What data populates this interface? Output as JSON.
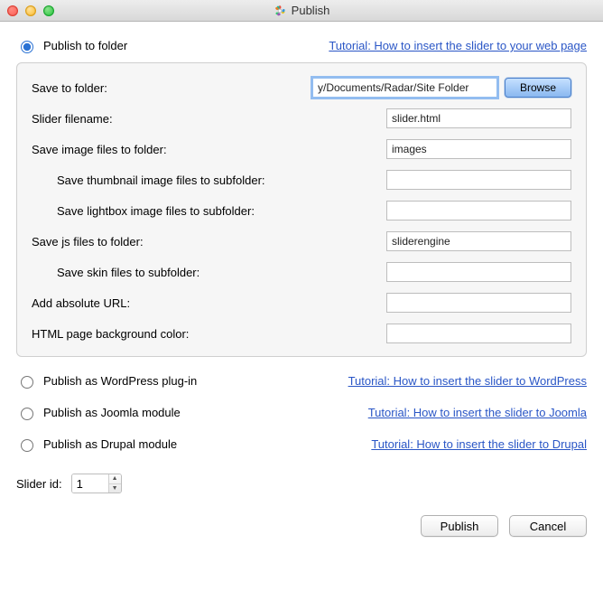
{
  "window": {
    "title": "Publish"
  },
  "options": {
    "folder": {
      "label": "Publish to folder",
      "selected": true,
      "tutorial": "Tutorial: How to insert the slider to your web page"
    },
    "wordpress": {
      "label": "Publish as WordPress plug-in",
      "selected": false,
      "tutorial": "Tutorial: How to insert the slider to WordPress"
    },
    "joomla": {
      "label": "Publish as Joomla module",
      "selected": false,
      "tutorial": "Tutorial: How to insert the slider to Joomla"
    },
    "drupal": {
      "label": "Publish as Drupal module",
      "selected": false,
      "tutorial": "Tutorial: How to insert the slider to Drupal"
    }
  },
  "form": {
    "save_folder": {
      "label": "Save to folder:",
      "value": "y/Documents/Radar/Site Folder",
      "browse": "Browse"
    },
    "slider_filename": {
      "label": "Slider filename:",
      "value": "slider.html"
    },
    "image_folder": {
      "label": "Save image files to folder:",
      "value": "images"
    },
    "thumb_subfolder": {
      "label": "Save thumbnail image files to subfolder:",
      "value": ""
    },
    "lightbox_subfolder": {
      "label": "Save lightbox image files to subfolder:",
      "value": ""
    },
    "js_folder": {
      "label": "Save js files to folder:",
      "value": "sliderengine"
    },
    "skin_subfolder": {
      "label": "Save skin files to subfolder:",
      "value": ""
    },
    "absolute_url": {
      "label": "Add absolute URL:",
      "value": ""
    },
    "bg_color": {
      "label": "HTML page background color:",
      "value": ""
    }
  },
  "slider_id": {
    "label": "Slider id:",
    "value": "1"
  },
  "buttons": {
    "publish": "Publish",
    "cancel": "Cancel"
  }
}
